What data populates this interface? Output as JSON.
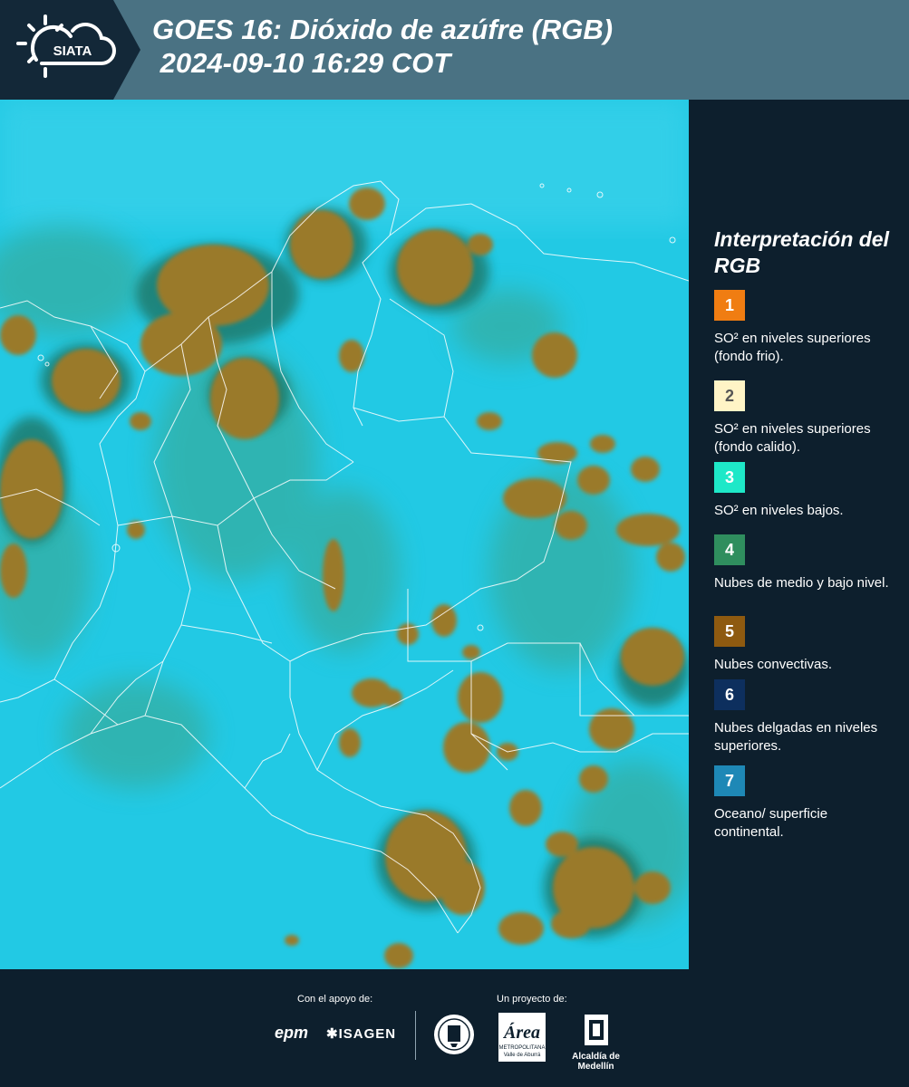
{
  "header": {
    "logo_text": "SIATA",
    "title_line1": "GOES 16: Dióxido de azúfre (RGB)",
    "title_line2": " 2024-09-10 16:29 COT"
  },
  "legend": {
    "title": "Interpretación del RGB",
    "items": [
      {
        "number": "1",
        "color": "#f07d12",
        "text": "SO² en niveles superiores (fondo frio)."
      },
      {
        "number": "2",
        "color": "#fff4c6",
        "text": "SO² en niveles superiores (fondo calido)."
      },
      {
        "number": "3",
        "color": "#1ee8c8",
        "text": "SO² en niveles bajos."
      },
      {
        "number": "4",
        "color": "#2f8e5e",
        "text": "Nubes de medio y bajo nivel."
      },
      {
        "number": "5",
        "color": "#8e5a10",
        "text": "Nubes convectivas."
      },
      {
        "number": "6",
        "color": "#0d2f5e",
        "text": "Nubes delgadas en niveles superiores."
      },
      {
        "number": "7",
        "color": "#1e88b6",
        "text": "Oceano/ superficie continental."
      }
    ]
  },
  "map": {
    "background_color": "#22c9e4",
    "cloud_color": "#9a7a2a",
    "border_color": "#ffffff"
  },
  "footer": {
    "support_label": "Con el apoyo de:",
    "project_label": "Un proyecto de:",
    "sponsor_logos": [
      "epm",
      "ISAGEN"
    ],
    "project_logos": [
      "Área Metropolitana Valle de Aburrá",
      "Alcaldía de Medellín"
    ],
    "area_logo_lines": [
      "METROPOLITANA",
      "Valle de Aburrá"
    ],
    "alcaldia_label": "Alcaldía de Medellín"
  }
}
